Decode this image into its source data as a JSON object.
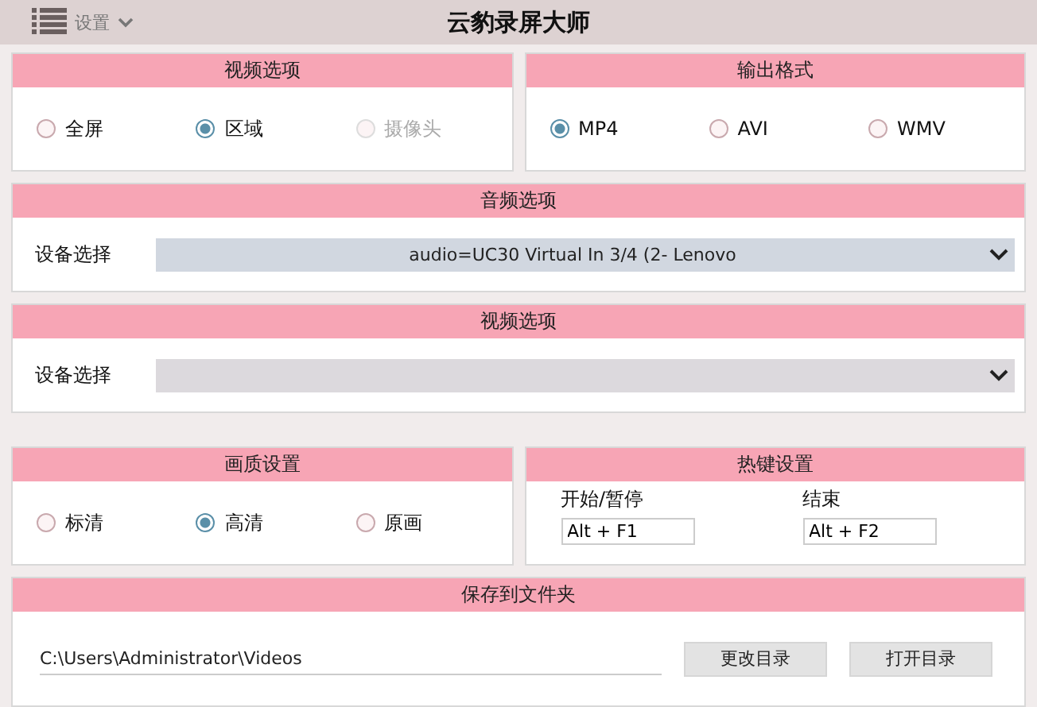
{
  "title_bar": {
    "menu_label": "设置",
    "title": "云豹录屏大师"
  },
  "video_options": {
    "header": "视频选项",
    "options": [
      {
        "label": "全屏",
        "selected": false,
        "disabled": false
      },
      {
        "label": "区域",
        "selected": true,
        "disabled": false
      },
      {
        "label": "摄像头",
        "selected": false,
        "disabled": true
      }
    ]
  },
  "output_format": {
    "header": "输出格式",
    "options": [
      {
        "label": "MP4",
        "selected": true,
        "disabled": false
      },
      {
        "label": "AVI",
        "selected": false,
        "disabled": false
      },
      {
        "label": "WMV",
        "selected": false,
        "disabled": false
      }
    ]
  },
  "audio_options": {
    "header": "音频选项",
    "label": "设备选择",
    "value": "audio=UC30 Virtual In 3/4 (2- Lenovo"
  },
  "video_device": {
    "header": "视频选项",
    "label": "设备选择"
  },
  "quality": {
    "header": "画质设置",
    "options": [
      {
        "label": "标清",
        "selected": false,
        "disabled": false
      },
      {
        "label": "高清",
        "selected": true,
        "disabled": false
      },
      {
        "label": "原画",
        "selected": false,
        "disabled": false
      }
    ]
  },
  "hotkeys": {
    "header": "热键设置",
    "items": [
      {
        "label": "开始/暂停",
        "value": "Alt + F1"
      },
      {
        "label": "结束",
        "value": "Alt + F2"
      }
    ]
  },
  "save_folder": {
    "header": "保存到文件夹",
    "path": "C:\\Users\\Administrator\\Videos",
    "buttons": [
      "更改目录",
      "打开目录"
    ]
  }
}
